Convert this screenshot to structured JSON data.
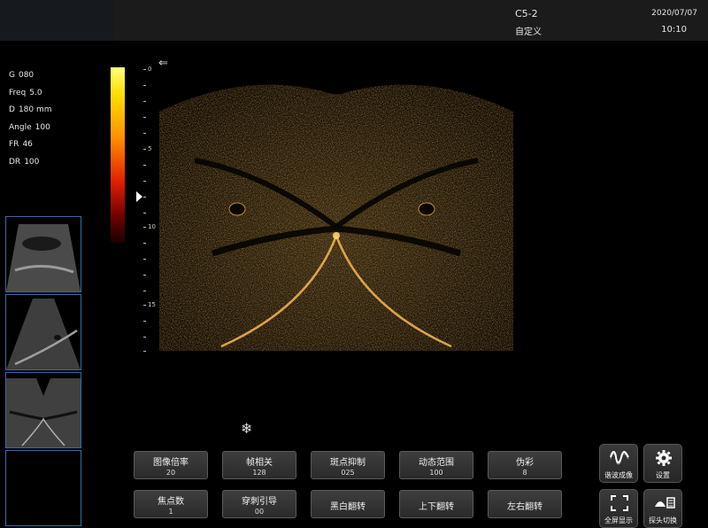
{
  "header": {
    "probe": "C5-2",
    "preset": "自定义",
    "date": "2020/07/07",
    "time": "10:10"
  },
  "params": [
    {
      "key": "G",
      "value": "080"
    },
    {
      "key": "Freq",
      "value": "5.0"
    },
    {
      "key": "D",
      "value": "180 mm"
    },
    {
      "key": "Angle",
      "value": "100"
    },
    {
      "key": "FR",
      "value": "46"
    },
    {
      "key": "DR",
      "value": "100"
    }
  ],
  "depth_scale": {
    "labels": [
      "0",
      "5",
      "10",
      "15"
    ]
  },
  "icons": {
    "direction": "arrow-left-icon",
    "focus": "focus-marker-icon",
    "freeze": "snowflake-icon",
    "harmonic": "harmonic-wave-icon",
    "settings": "gear-icon",
    "fullscreen": "fullscreen-icon",
    "probe_switch": "probe-switch-icon"
  },
  "colors": {
    "accent": "#3a6aa0",
    "button_bg": "#333333",
    "tint": "#c98a2a"
  },
  "controls": {
    "row1": [
      {
        "label": "图像倍率",
        "value": "20"
      },
      {
        "label": "帧相关",
        "value": "128"
      },
      {
        "label": "斑点抑制",
        "value": "025"
      },
      {
        "label": "动态范围",
        "value": "100"
      },
      {
        "label": "伪彩",
        "value": "8"
      }
    ],
    "row2": [
      {
        "label": "焦点数",
        "value": "1"
      },
      {
        "label": "穿刺引导",
        "value": "00"
      },
      {
        "label": "黑白翻转",
        "value": ""
      },
      {
        "label": "上下翻转",
        "value": ""
      },
      {
        "label": "左右翻转",
        "value": ""
      }
    ]
  },
  "tools": [
    {
      "label": "谐波成像"
    },
    {
      "label": "设置"
    },
    {
      "label": "全屏显示"
    },
    {
      "label": "探头切换"
    }
  ]
}
